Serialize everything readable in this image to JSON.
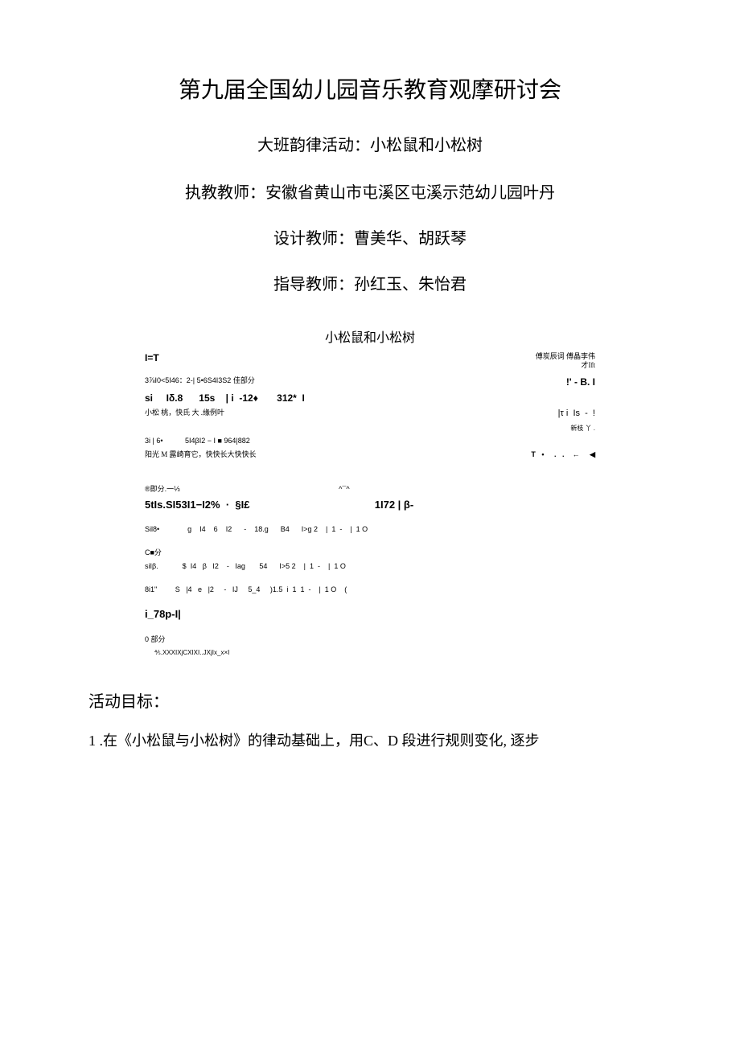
{
  "title": "第九届全国幼儿园音乐教育观摩研讨会",
  "subtitle": "大班韵律活动：小松鼠和小松树",
  "teachers": {
    "executor": "执教教师：安徽省黄山市屯溪区屯溪示范幼儿园叶丹",
    "designer": "设计教师：曹美华、胡跃琴",
    "advisor": "指导教师：孙红玉、朱怡君"
  },
  "score": {
    "title": "小松鼠和小松树",
    "credit1": "傅炭辰词 傅晶李伟",
    "credit2": "才Ift",
    "row_it": "I=T",
    "row1": "3⅞I0<5I46：2-| 5•6S4I3S2 佳部分",
    "row1_right": "!' - B. I",
    "row2": "si     Iδ.8      15s    | i  -12♦       312*  I",
    "row3_left": "小松      桃，快氏                大    .缘例叶",
    "row3_right": "|τ i  Is  -  !",
    "row3_right2": "新枝 丫 .",
    "row4": "3i | 6•           5I4βI2 − I ■ 964|882",
    "row5_left": "阳光 M 露崎育它，快快长大快快长",
    "row5_right": "T   •     .   .    ←     ◀",
    "row6": "®即分.一⅓                                                                               ^¯^",
    "row7": "5tIs.SI53I1−I2%  ·  §I£                                           1I72 | β-",
    "row8": "Sil8•              g    I4    6    I2      -    18.g      B4      I>g 2    |  1  -    |  1 O",
    "row9": "C■分",
    "row10": "siIβ.            $  I4   β   I2    -   Iag       54      I>5 2    |  1  -    |  1 O",
    "row11": "8i1\"         S   |4   e   |2     -   IJ     5_4     )1.5  i  1  1  -    |  1 O    (",
    "row12": "i_78p-I|",
    "row13": "0 部分",
    "row14": "⅘.XXXIXjCXIXI..JXjIx_x×I"
  },
  "section_heading": "活动目标：",
  "body1": "1 .在《小松鼠与小松树》的律动基础上，用C、D 段进行规则变化, 逐步"
}
